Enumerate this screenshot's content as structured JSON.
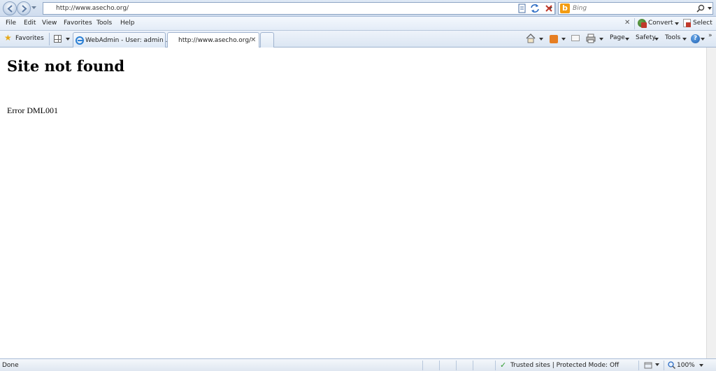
{
  "address_bar": {
    "url": "http://www.asecho.org/",
    "search_placeholder": "Bing"
  },
  "menu": {
    "items": [
      "File",
      "Edit",
      "View",
      "Favorites",
      "Tools",
      "Help"
    ],
    "convert_label": "Convert",
    "select_label": "Select"
  },
  "tabs_row": {
    "favorites_label": "Favorites",
    "tabs": [
      {
        "label": "WebAdmin - User: admin ...",
        "active": false
      },
      {
        "label": "http://www.asecho.org/",
        "active": true
      }
    ],
    "commands": {
      "page": "Page",
      "safety": "Safety",
      "tools": "Tools"
    }
  },
  "content": {
    "title": "Site not found",
    "error": "Error DML001"
  },
  "status_bar": {
    "status": "Done",
    "zone": "Trusted sites | Protected Mode: Off",
    "zoom": "100%"
  },
  "colors": {
    "chrome_blue": "#dfe9f5",
    "bing_orange": "#f39c12",
    "trusted_green": "#2e9b2e"
  }
}
